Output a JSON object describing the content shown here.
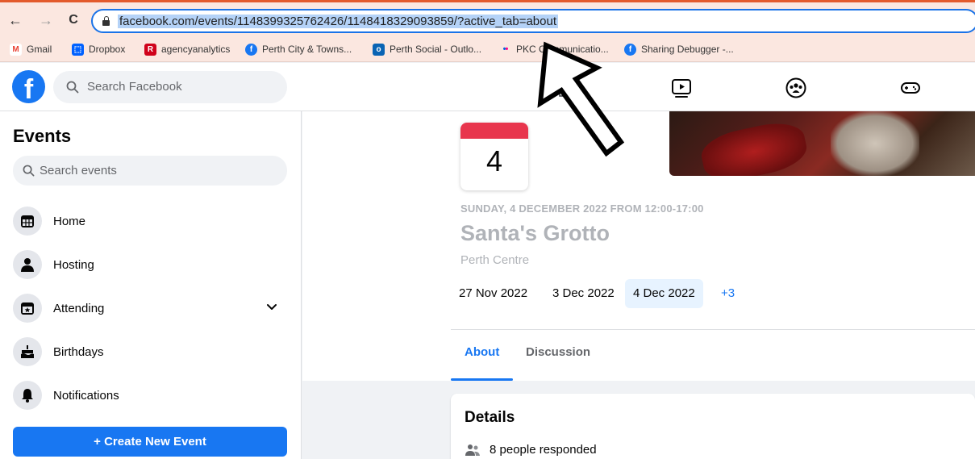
{
  "browser": {
    "url": "facebook.com/events/1148399325762426/1148418329093859/?active_tab=about",
    "nav": {
      "back": "←",
      "forward": "→",
      "reload": "C"
    }
  },
  "bookmarks": [
    {
      "label": "Gmail",
      "icon": "gmail-icon",
      "color": "#ea4335",
      "glyph": "M"
    },
    {
      "label": "Dropbox",
      "icon": "dropbox-icon",
      "color": "#0061ff",
      "glyph": "⬚"
    },
    {
      "label": "agencyanalytics",
      "icon": "agencyanalytics-icon",
      "color": "#d0021b",
      "glyph": "R"
    },
    {
      "label": "Perth City & Towns...",
      "icon": "facebook-icon",
      "color": "#1877f2",
      "glyph": "f"
    },
    {
      "label": "Perth Social - Outlo...",
      "icon": "outlook-icon",
      "color": "#0a64b4",
      "glyph": "o"
    },
    {
      "label": "PKC Communicatio...",
      "icon": "flickr-icon",
      "color": "#ffffff",
      "glyph": "••"
    },
    {
      "label": "Sharing Debugger -...",
      "icon": "facebook-icon",
      "color": "#1877f2",
      "glyph": "f"
    }
  ],
  "header": {
    "logo": "f",
    "search_placeholder": "Search Facebook"
  },
  "sidebar": {
    "title": "Events",
    "search_placeholder": "Search events",
    "items": [
      {
        "label": "Home",
        "icon": "calendar-grid-icon"
      },
      {
        "label": "Hosting",
        "icon": "person-icon"
      },
      {
        "label": "Attending",
        "icon": "calendar-star-icon"
      },
      {
        "label": "Birthdays",
        "icon": "cake-icon"
      },
      {
        "label": "Notifications",
        "icon": "bell-icon"
      }
    ],
    "create_button": "+ Create New Event"
  },
  "event": {
    "day_number": "4",
    "date_line": "SUNDAY, 4 DECEMBER 2022 FROM 12:00-17:00",
    "title": "Santa's Grotto",
    "location": "Perth Centre",
    "dates": [
      "27 Nov 2022",
      "3 Dec 2022",
      "4 Dec 2022"
    ],
    "selected_date": "4 Dec 2022",
    "more_dates": "+3",
    "tabs": [
      "About",
      "Discussion"
    ],
    "active_tab": "About"
  },
  "details": {
    "heading": "Details",
    "responded": "8 people responded"
  },
  "colors": {
    "brand": "#1877f2",
    "calendar_band": "#e8354d",
    "chrome_bg": "#fbe7e0"
  }
}
